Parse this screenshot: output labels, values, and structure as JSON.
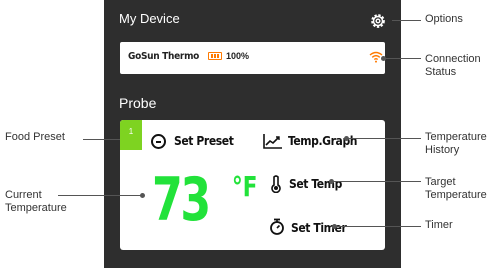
{
  "device": {
    "title": "My Device",
    "settings_icon": "gear-icon",
    "connection": {
      "name": "GoSun Thermo",
      "battery_icon": "battery-icon",
      "battery_percent": "100%",
      "signal_icon": "wifi-icon",
      "signal_color": "#ff7a00"
    }
  },
  "probe": {
    "section_title": "Probe",
    "preset_number": "1",
    "preset_color": "#7ed321",
    "set_preset_label": "Set Preset",
    "graph_label": "Temp.Graph",
    "set_temp_label": "Set Temp",
    "set_timer_label": "Set Timer",
    "temperature_value": "73",
    "temperature_unit": "°F",
    "temperature_color": "#22e23a"
  },
  "annotations": {
    "options": "Options",
    "connection_status": "Connection\nStatus",
    "food_preset": "Food Preset",
    "current_temperature": "Current\nTemperature",
    "temperature_history": "Temperature\nHistory",
    "target_temperature": "Target\nTemperature",
    "timer": "Timer"
  }
}
